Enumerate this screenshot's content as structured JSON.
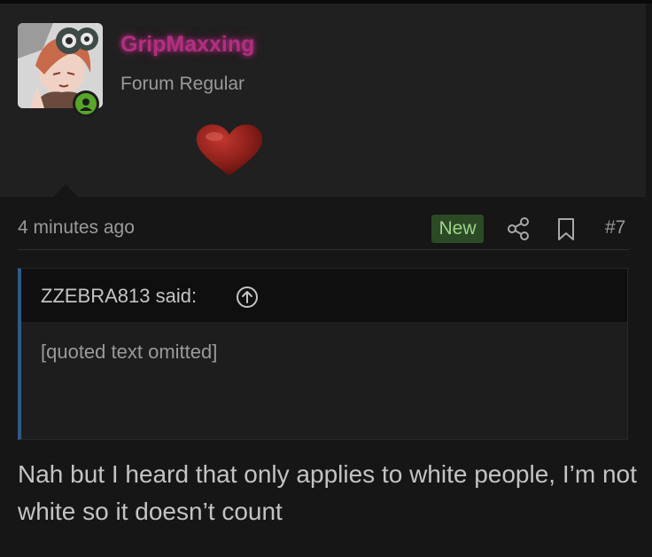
{
  "user": {
    "username": "GripMaxxing",
    "title": "Forum Regular",
    "username_color": "#b0307f",
    "presence_color": "#57a62a",
    "avatar_icon": "anime-avatar-icon",
    "decoration_icon": "heart-icon"
  },
  "post": {
    "time": "4 minutes ago",
    "badge": "New",
    "number": "#7",
    "share_icon": "share-icon",
    "bookmark_icon": "bookmark-icon",
    "body": "Nah but I heard that only applies to white people, I’m not white so it doesn’t count"
  },
  "quote": {
    "author": "ZZEBRA813 said:",
    "jump_icon": "arrow-up-circle-icon",
    "text": "[quoted text omitted]"
  }
}
